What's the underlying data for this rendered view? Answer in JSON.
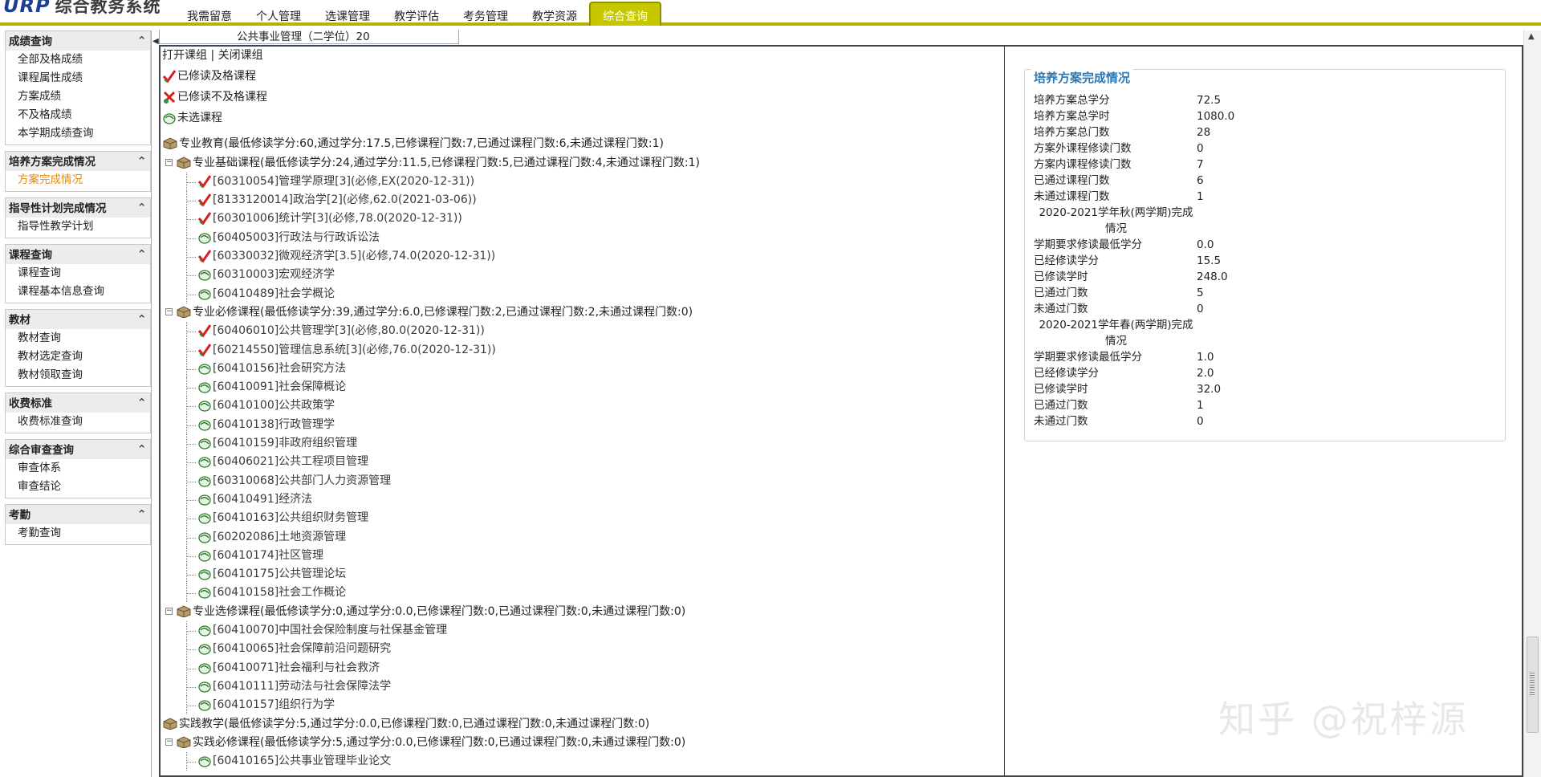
{
  "app": {
    "logo_latin": "URP",
    "logo_cn": "综合教务系统"
  },
  "tabs": [
    {
      "label": "我需留意"
    },
    {
      "label": "个人管理"
    },
    {
      "label": "选课管理"
    },
    {
      "label": "教学评估"
    },
    {
      "label": "考务管理"
    },
    {
      "label": "教学资源"
    },
    {
      "label": "综合查询",
      "active": true
    }
  ],
  "sidebar": [
    {
      "title": "成绩查询",
      "items": [
        "全部及格成绩",
        "课程属性成绩",
        "方案成绩",
        "不及格成绩",
        "本学期成绩查询"
      ]
    },
    {
      "title": "培养方案完成情况",
      "items": [
        "方案完成情况"
      ],
      "highlight": 0
    },
    {
      "title": "指导性计划完成情况",
      "items": [
        "指导性教学计划"
      ]
    },
    {
      "title": "课程查询",
      "items": [
        "课程查询",
        "课程基本信息查询"
      ]
    },
    {
      "title": "教材",
      "items": [
        "教材查询",
        "教材选定查询",
        "教材领取查询"
      ]
    },
    {
      "title": "收费标准",
      "items": [
        "收费标准查询"
      ]
    },
    {
      "title": "综合审查查询",
      "items": [
        "审查体系",
        "审查结论"
      ]
    },
    {
      "title": "考勤",
      "items": [
        "考勤查询"
      ]
    }
  ],
  "breadcrumb": "公共事业管理（二学位）20",
  "tree_toggle": {
    "open": "打开课组",
    "sep": " | ",
    "close": "关闭课组"
  },
  "legend": {
    "pass": "已修读及格课程",
    "fail": "已修读不及格课程",
    "none": "未选课程"
  },
  "tree": [
    {
      "level": 0,
      "kind": "group",
      "text": "专业教育(最低修读学分:60,通过学分:17.5,已修课程门数:7,已通过课程门数:6,未通过课程门数:1)"
    },
    {
      "level": 1,
      "kind": "group",
      "text": "专业基础课程(最低修读学分:24,通过学分:11.5,已修课程门数:5,已通过课程门数:4,未通过课程门数:1)"
    },
    {
      "level": 2,
      "kind": "pass",
      "text": "[60310054]管理学原理[3](必修,EX(2020-12-31))"
    },
    {
      "level": 2,
      "kind": "pass",
      "text": "[8133120014]政治学[2](必修,62.0(2021-03-06))"
    },
    {
      "level": 2,
      "kind": "pass",
      "text": "[60301006]统计学[3](必修,78.0(2020-12-31))"
    },
    {
      "level": 2,
      "kind": "none",
      "text": "[60405003]行政法与行政诉讼法"
    },
    {
      "level": 2,
      "kind": "pass",
      "text": "[60330032]微观经济学[3.5](必修,74.0(2020-12-31))"
    },
    {
      "level": 2,
      "kind": "none",
      "text": "[60310003]宏观经济学"
    },
    {
      "level": 2,
      "kind": "none",
      "text": "[60410489]社会学概论"
    },
    {
      "level": 1,
      "kind": "group",
      "text": "专业必修课程(最低修读学分:39,通过学分:6.0,已修课程门数:2,已通过课程门数:2,未通过课程门数:0)"
    },
    {
      "level": 2,
      "kind": "pass",
      "text": "[60406010]公共管理学[3](必修,80.0(2020-12-31))"
    },
    {
      "level": 2,
      "kind": "pass",
      "text": "[60214550]管理信息系统[3](必修,76.0(2020-12-31))"
    },
    {
      "level": 2,
      "kind": "none",
      "text": "[60410156]社会研究方法"
    },
    {
      "level": 2,
      "kind": "none",
      "text": "[60410091]社会保障概论"
    },
    {
      "level": 2,
      "kind": "none",
      "text": "[60410100]公共政策学"
    },
    {
      "level": 2,
      "kind": "none",
      "text": "[60410138]行政管理学"
    },
    {
      "level": 2,
      "kind": "none",
      "text": "[60410159]非政府组织管理"
    },
    {
      "level": 2,
      "kind": "none",
      "text": "[60406021]公共工程项目管理"
    },
    {
      "level": 2,
      "kind": "none",
      "text": "[60310068]公共部门人力资源管理"
    },
    {
      "level": 2,
      "kind": "none",
      "text": "[60410491]经济法"
    },
    {
      "level": 2,
      "kind": "none",
      "text": "[60410163]公共组织财务管理"
    },
    {
      "level": 2,
      "kind": "none",
      "text": "[60202086]土地资源管理"
    },
    {
      "level": 2,
      "kind": "none",
      "text": "[60410174]社区管理"
    },
    {
      "level": 2,
      "kind": "none",
      "text": "[60410175]公共管理论坛"
    },
    {
      "level": 2,
      "kind": "none",
      "text": "[60410158]社会工作概论"
    },
    {
      "level": 1,
      "kind": "group",
      "text": "专业选修课程(最低修读学分:0,通过学分:0.0,已修课程门数:0,已通过课程门数:0,未通过课程门数:0)"
    },
    {
      "level": 2,
      "kind": "none",
      "text": "[60410070]中国社会保险制度与社保基金管理"
    },
    {
      "level": 2,
      "kind": "none",
      "text": "[60410065]社会保障前沿问题研究"
    },
    {
      "level": 2,
      "kind": "none",
      "text": "[60410071]社会福利与社会救济"
    },
    {
      "level": 2,
      "kind": "none",
      "text": "[60410111]劳动法与社会保障法学"
    },
    {
      "level": 2,
      "kind": "none",
      "text": "[60410157]组织行为学"
    },
    {
      "level": 0,
      "kind": "group",
      "text": "实践教学(最低修读学分:5,通过学分:0.0,已修课程门数:0,已通过课程门数:0,未通过课程门数:0)"
    },
    {
      "level": 1,
      "kind": "group",
      "text": "实践必修课程(最低修读学分:5,通过学分:0.0,已修课程门数:0,已通过课程门数:0,未通过课程门数:0)"
    },
    {
      "level": 2,
      "kind": "none",
      "text": "[60410165]公共事业管理毕业论文"
    }
  ],
  "panel": {
    "title": "培养方案完成情况",
    "rows": [
      {
        "k": "培养方案总学分",
        "v": "72.5"
      },
      {
        "k": "培养方案总学时",
        "v": "1080.0"
      },
      {
        "k": "培养方案总门数",
        "v": "28"
      },
      {
        "k": "方案外课程修读门数",
        "v": "0"
      },
      {
        "k": "方案内课程修读门数",
        "v": "7"
      },
      {
        "k": "已通过课程门数",
        "v": "6"
      },
      {
        "k": "未通过课程门数",
        "v": "1"
      },
      {
        "sem1": "2020-2021学年秋(两学期)完成",
        "sem2": "情况"
      },
      {
        "k": "学期要求修读最低学分",
        "v": "0.0"
      },
      {
        "k": "已经修读学分",
        "v": "15.5"
      },
      {
        "k": "已修读学时",
        "v": "248.0"
      },
      {
        "k": "已通过门数",
        "v": "5"
      },
      {
        "k": "未通过门数",
        "v": "0"
      },
      {
        "sem1": "2020-2021学年春(两学期)完成",
        "sem2": "情况"
      },
      {
        "k": "学期要求修读最低学分",
        "v": "1.0"
      },
      {
        "k": "已经修读学分",
        "v": "2.0"
      },
      {
        "k": "已修读学时",
        "v": "32.0"
      },
      {
        "k": "已通过门数",
        "v": "1"
      },
      {
        "k": "未通过门数",
        "v": "0"
      }
    ]
  },
  "watermark": "知乎 @祝梓源"
}
